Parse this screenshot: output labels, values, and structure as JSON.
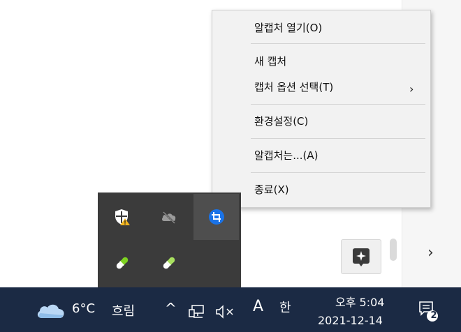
{
  "context_menu": {
    "items": [
      {
        "label": "알캡처 열기(O)"
      },
      {
        "label": "새 캡처"
      },
      {
        "label": "캡처 옵션 선택(T)",
        "submenu_arrow": "›"
      },
      {
        "label": "환경설정(C)"
      },
      {
        "label": "알캡처는...(A)"
      },
      {
        "label": "종료(X)"
      }
    ]
  },
  "tray_overflow": {
    "icons": [
      {
        "name": "windows-security-warning-icon"
      },
      {
        "name": "onedrive-offline-icon"
      },
      {
        "name": "alcapture-icon",
        "color": "#1a73e8"
      },
      {
        "name": "pill-icon-1"
      },
      {
        "name": "pill-icon-2"
      }
    ]
  },
  "taskbar": {
    "weather_temp": "6°C",
    "weather_desc": "흐림",
    "show_hidden_icons": "^",
    "ime_mode": "A",
    "ime_lang": "한",
    "clock_time": "오후 5:04",
    "clock_date": "2021-12-14",
    "notification_count": "2",
    "background": "#1b2a44"
  },
  "page": {
    "right_arrow": "›"
  }
}
